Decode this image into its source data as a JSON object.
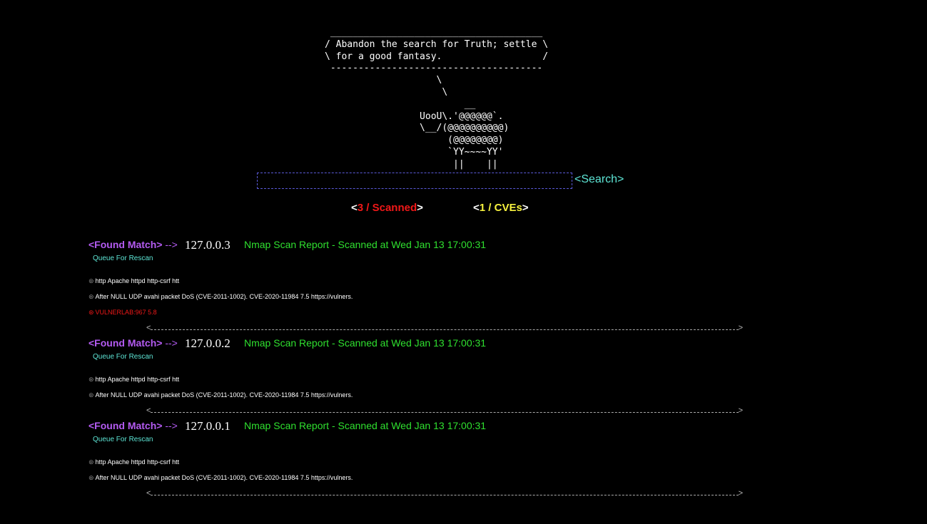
{
  "ascii_art": " ______________________________________\n/ Abandon the search for Truth; settle \\\n\\ for a good fantasy.                  /\n --------------------------------------\n                    \\\n                     \\\n                         __\n                 UooU\\.'@@@@@@`.\n                 \\__/(@@@@@@@@@@)\n                      (@@@@@@@@)\n                      `YY~~~~YY'\n                       ||    ||",
  "search": {
    "placeholder": "",
    "button_label": "<Search>"
  },
  "stats": {
    "scanned": {
      "open": "<",
      "value": "3 / Scanned",
      "close": ">"
    },
    "cves": {
      "open": "<",
      "value": "1 / CVEs",
      "close": ">"
    }
  },
  "results": [
    {
      "found_label": "<Found Match>",
      "arrow": "-->",
      "ip": "127.0.0.3",
      "report": "Nmap Scan Report - Scanned at Wed Jan 13 17:00:31",
      "queue_label": "Queue For Rescan",
      "lines": [
        "http  Apache httpd  http-csrf  htt",
        "After NULL UDP avahi packet DoS (CVE-2011-1002). CVE-2020-11984 7.5 https://vulners.",
        "VULNERLAB:967 5.8"
      ]
    },
    {
      "found_label": "<Found Match>",
      "arrow": "-->",
      "ip": "127.0.0.2",
      "report": "Nmap Scan Report - Scanned at Wed Jan 13 17:00:31",
      "queue_label": "Queue For Rescan",
      "lines": [
        "http  Apache httpd  http-csrf  htt",
        "After NULL UDP avahi packet DoS (CVE-2011-1002). CVE-2020-11984 7.5 https://vulners."
      ]
    },
    {
      "found_label": "<Found Match>",
      "arrow": "-->",
      "ip": "127.0.0.1",
      "report": "Nmap Scan Report - Scanned at Wed Jan 13 17:00:31",
      "queue_label": "Queue For Rescan",
      "lines": [
        "http  Apache httpd  http-csrf  htt",
        "After NULL UDP avahi packet DoS (CVE-2011-1002). CVE-2020-11984 7.5 https://vulners."
      ]
    }
  ],
  "separator": {
    "left": "<",
    "right": ">"
  },
  "bullet_glyph": "⊛",
  "colors": {
    "found_match": "#b45bf2",
    "report": "#2fe02f",
    "queue": "#5ee6d6",
    "scanned": "#f01818",
    "cves": "#f7f23e",
    "search_border": "#5a5ad8"
  }
}
